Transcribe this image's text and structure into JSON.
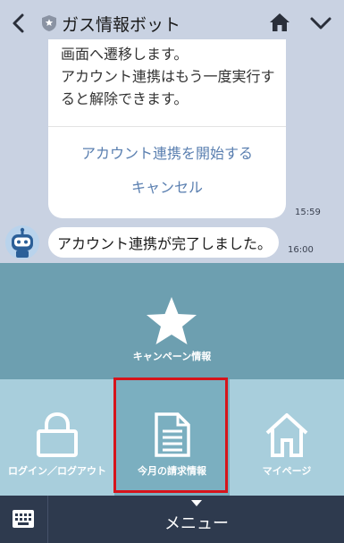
{
  "header": {
    "title": "ガス情報ボット",
    "back_icon": "chevron-left-icon",
    "home_icon": "home-icon",
    "expand_icon": "chevron-down-icon"
  },
  "chat": {
    "card_text": "画面へ遷移します。\nアカウント連携はもう一度実行すると解除できます。",
    "card_actions": [
      "アカウント連携を開始する",
      "キャンセル"
    ],
    "card_time": "15:59",
    "message": "アカウント連携が完了しました。",
    "message_time": "16:00"
  },
  "rich_menu": {
    "campaign_label": "キャンペーン情報",
    "tiles": [
      {
        "label": "ログイン／ログアウト",
        "icon": "lock-icon"
      },
      {
        "label": "今月の請求情報",
        "icon": "document-icon"
      },
      {
        "label": "マイページ",
        "icon": "house-icon"
      }
    ],
    "highlighted_tile": "今月の請求情報"
  },
  "footer": {
    "menu_label": "メニュー",
    "keyboard_icon": "keyboard-icon"
  },
  "colors": {
    "background": "#c9d2e2",
    "campaign_bg": "#6d9fb0",
    "tile_bg": "#a8cedc",
    "tile_selected_bg": "#7bafc0",
    "highlight_border": "#d6141b",
    "footer_bg": "#2e3a4e",
    "link": "#5a7fb0"
  }
}
